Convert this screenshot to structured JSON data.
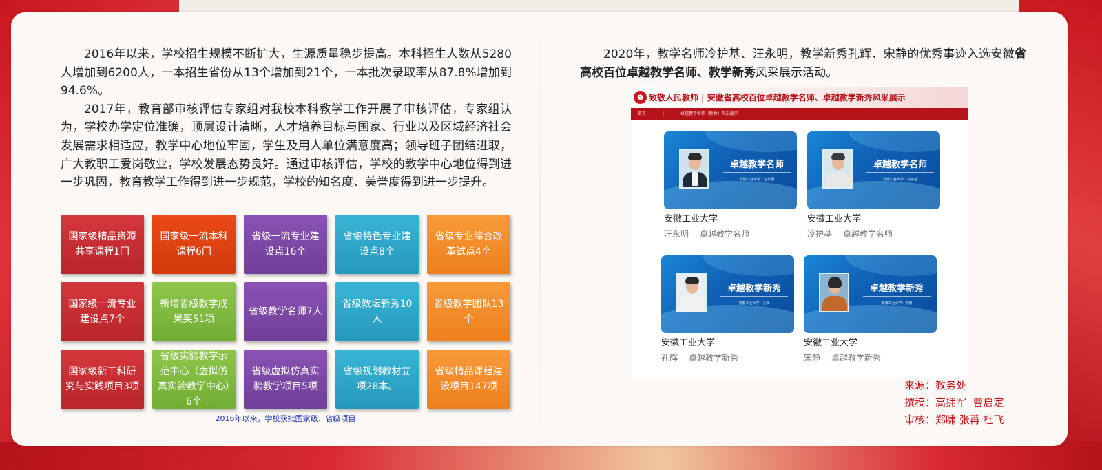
{
  "left": {
    "paragraphs": [
      "2016年以来，学校招生规模不断扩大，生源质量稳步提高。本科招生人数从5280人增加到6200人，一本招生省份从13个增加到21个，一本批次录取率从87.8%增加到94.6%。",
      "2017年，教育部审核评估专家组对我校本科教学工作开展了审核评估，专家组认为，学校办学定位准确，顶层设计清晰，人才培养目标与国家、行业以及区域经济社会发展需求相适应，教学中心地位牢固，学生及用人单位满意度高；领导班子团结进取，广大教职工爱岗敬业，学校发展态势良好。通过审核评估，学校的教学中心地位得到进一步巩固，教育教学工作得到进一步规范，学校的知名度、美誉度得到进一步提升。"
    ],
    "tiles": [
      {
        "text": "国家级精品资源共享课程1门",
        "color": "red"
      },
      {
        "text": "国家级一流本科课程6门",
        "color": "orange-red"
      },
      {
        "text": "省级一流专业建设点16个",
        "color": "purple"
      },
      {
        "text": "省级特色专业建设点8个",
        "color": "cyan"
      },
      {
        "text": "省级专业综合改革试点4个",
        "color": "orange"
      },
      {
        "text": "国家级一流专业建设点7个",
        "color": "red"
      },
      {
        "text": "新增省级教学成果奖51项",
        "color": "green"
      },
      {
        "text": "省级教学名师7人",
        "color": "purple"
      },
      {
        "text": "省级教坛新秀10人",
        "color": "cyan"
      },
      {
        "text": "省级教学团队13个",
        "color": "orange"
      },
      {
        "text": "国家级新工科研究与实践项目3项",
        "color": "red"
      },
      {
        "text": "省级实验教学示范中心（虚拟仿真实验教学中心）6个",
        "color": "green"
      },
      {
        "text": "省级虚拟仿真实验教学项目5项",
        "color": "purple"
      },
      {
        "text": "省级规划教材立项28本。",
        "color": "cyan"
      },
      {
        "text": "省级精品课程建设项目147项",
        "color": "orange"
      }
    ],
    "caption": "2016年以来，学校获批国家级、省级项目"
  },
  "right": {
    "intro_a": "2020年，教学名师冷护基、汪永明，教学新秀孔辉、宋静的优秀事迹入选安徽",
    "intro_bold": "省高校百位卓越教学名师、教学新秀",
    "intro_b": "风采展示活动。",
    "web": {
      "logo": "e",
      "header": "致敬人民教师 | 安徽省高校百位卓越教学名师、卓越教学新秀风采展示",
      "nav": [
        "首页",
        "|",
        "卓越教学名师（新秀）风采展示"
      ],
      "teachers": [
        {
          "badge": "卓越教学名师",
          "sub": "安徽工业大学：汪永明",
          "school": "安徽工业大学",
          "name": "汪永明",
          "title": "卓越教学名师"
        },
        {
          "badge": "卓越教学名师",
          "sub": "安徽工业大学：冷护基",
          "school": "安徽工业大学",
          "name": "冷护基",
          "title": "卓越教学名师"
        },
        {
          "badge": "卓越教学新秀",
          "sub": "安徽工业大学：孔辉",
          "school": "安徽工业大学",
          "name": "孔辉",
          "title": "卓越教学新秀"
        },
        {
          "badge": "卓越教学新秀",
          "sub": "安徽工业大学：宋静",
          "school": "安徽工业大学",
          "name": "宋静",
          "title": "卓越教学新秀"
        }
      ]
    },
    "credits": [
      "来源：教务处",
      "撰稿：高拥军  曹启定",
      "审核：郑啸 张苒 杜飞"
    ]
  },
  "colors": {
    "red": "#c8171e",
    "caption_blue": "#1e2fb8",
    "card_blue": "#0f5fb4"
  }
}
